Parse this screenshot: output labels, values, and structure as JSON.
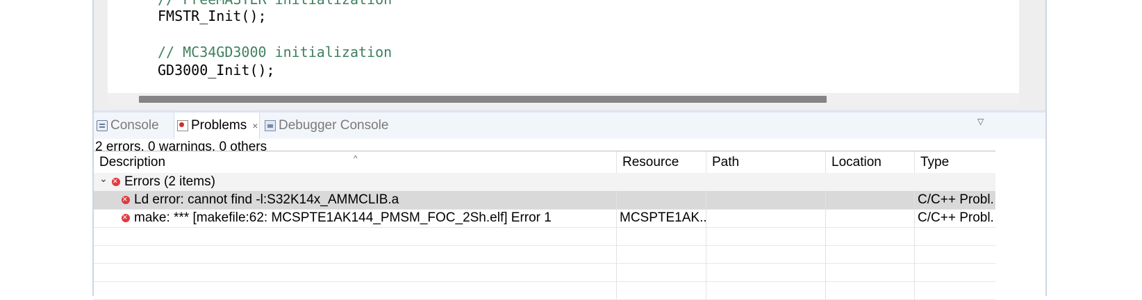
{
  "editor": {
    "lines": [
      {
        "text": "// FreeMASTER initialization",
        "kind": "comment"
      },
      {
        "text": "FMSTR_Init();",
        "kind": "code"
      },
      {
        "text": "",
        "kind": "code"
      },
      {
        "text": "// MC34GD3000 initialization",
        "kind": "comment"
      },
      {
        "text": "GD3000_Init();",
        "kind": "code"
      }
    ]
  },
  "tabs": [
    {
      "label": "Console",
      "active": false,
      "icon": "console-icon"
    },
    {
      "label": "Problems",
      "active": true,
      "icon": "problems-icon",
      "close": "×"
    },
    {
      "label": "Debugger Console",
      "active": false,
      "icon": "debugger-console-icon"
    }
  ],
  "summary": "2 errors, 0 warnings, 0 others",
  "table": {
    "columns": [
      "Description",
      "Resource",
      "Path",
      "Location",
      "Type"
    ],
    "group": {
      "label": "Errors (2 items)",
      "expanded": true
    },
    "rows": [
      {
        "description": "Ld error: cannot find -l:S32K14x_AMMCLIB.a",
        "resource": "",
        "path": "",
        "location": "",
        "type": "C/C++ Probl.",
        "selected": true
      },
      {
        "description": "make: *** [makefile:62: MCSPTE1AK144_PMSM_FOC_2Sh.elf] Error 1",
        "resource": "MCSPTE1AK...",
        "path": "",
        "location": "",
        "type": "C/C++ Probl.",
        "selected": false
      }
    ]
  },
  "colors": {
    "comment": "#3f7f5f",
    "error": "#e0393e",
    "selection": "#d9d9d9"
  }
}
